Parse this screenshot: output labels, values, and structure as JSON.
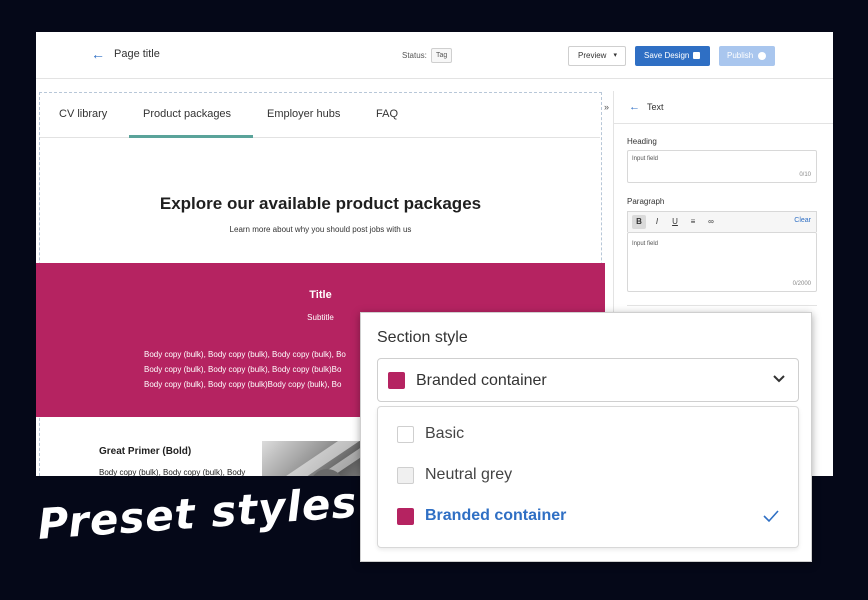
{
  "header": {
    "page_title": "Page title",
    "status_label": "Status:",
    "status_tag": "Tag",
    "preview_label": "Preview",
    "save_label": "Save Design",
    "publish_label": "Publish"
  },
  "tabs": [
    {
      "label": "CV library"
    },
    {
      "label": "Product packages"
    },
    {
      "label": "Employer hubs"
    },
    {
      "label": "FAQ"
    }
  ],
  "hero": {
    "title": "Explore our available product packages",
    "subtitle": "Learn more about why you should post jobs with us"
  },
  "branded_section": {
    "title": "Title",
    "subtitle": "Subtitle",
    "body_lines": [
      "Body copy (bulk), Body copy (bulk), Body copy (bulk), Bo",
      "Body copy (bulk), Body copy (bulk), Body copy (bulk)Bo",
      "Body copy (bulk), Body copy (bulk)Body copy (bulk), Bo"
    ]
  },
  "content_block": {
    "title": "Great Primer (Bold)",
    "body": "Body copy (bulk), Body copy (bulk), Body copy (bulk), Body copy (bulk)Body copy (bulk), Body copy"
  },
  "right_panel": {
    "title": "Text",
    "heading_label": "Heading",
    "heading_placeholder": "Input field",
    "heading_count": "0/10",
    "paragraph_label": "Paragraph",
    "paragraph_placeholder": "Input field",
    "paragraph_count": "0/2000",
    "clear_label": "Clear",
    "toolbar": {
      "bold": "B",
      "italic": "I",
      "underline": "U"
    }
  },
  "section_style": {
    "label": "Section style",
    "selected_value": "Branded container",
    "options": [
      {
        "label": "Basic",
        "color": "#ffffff",
        "selected": false
      },
      {
        "label": "Neutral grey",
        "color": "#f0f0f0",
        "selected": false
      },
      {
        "label": "Branded container",
        "color": "#b52361",
        "selected": true
      }
    ]
  },
  "promo_text": "Preset styles",
  "colors": {
    "brand": "#b52361",
    "accent_blue": "#2f6fc4",
    "tab_underline": "#5aa39a",
    "background": "#050818"
  }
}
